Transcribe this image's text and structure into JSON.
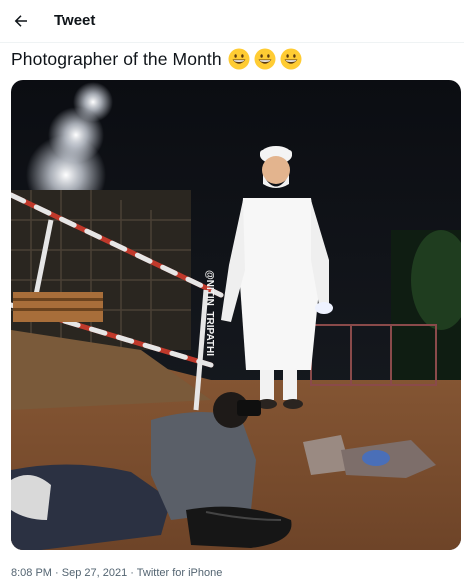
{
  "header": {
    "title": "Tweet",
    "back_icon": "arrow-left-icon"
  },
  "tweet": {
    "text": "Photographer of the Month",
    "emojis": [
      "grinning-face-emoji",
      "grinning-face-emoji",
      "grinning-face-emoji"
    ],
    "watermark": "@NITIN_TRIPATHI",
    "timestamp": "8:08 PM · Sep 27, 2021 · Twitter for iPhone"
  },
  "colors": {
    "text": "#0f1419",
    "meta": "#536471",
    "divider": "#eff3f4"
  }
}
